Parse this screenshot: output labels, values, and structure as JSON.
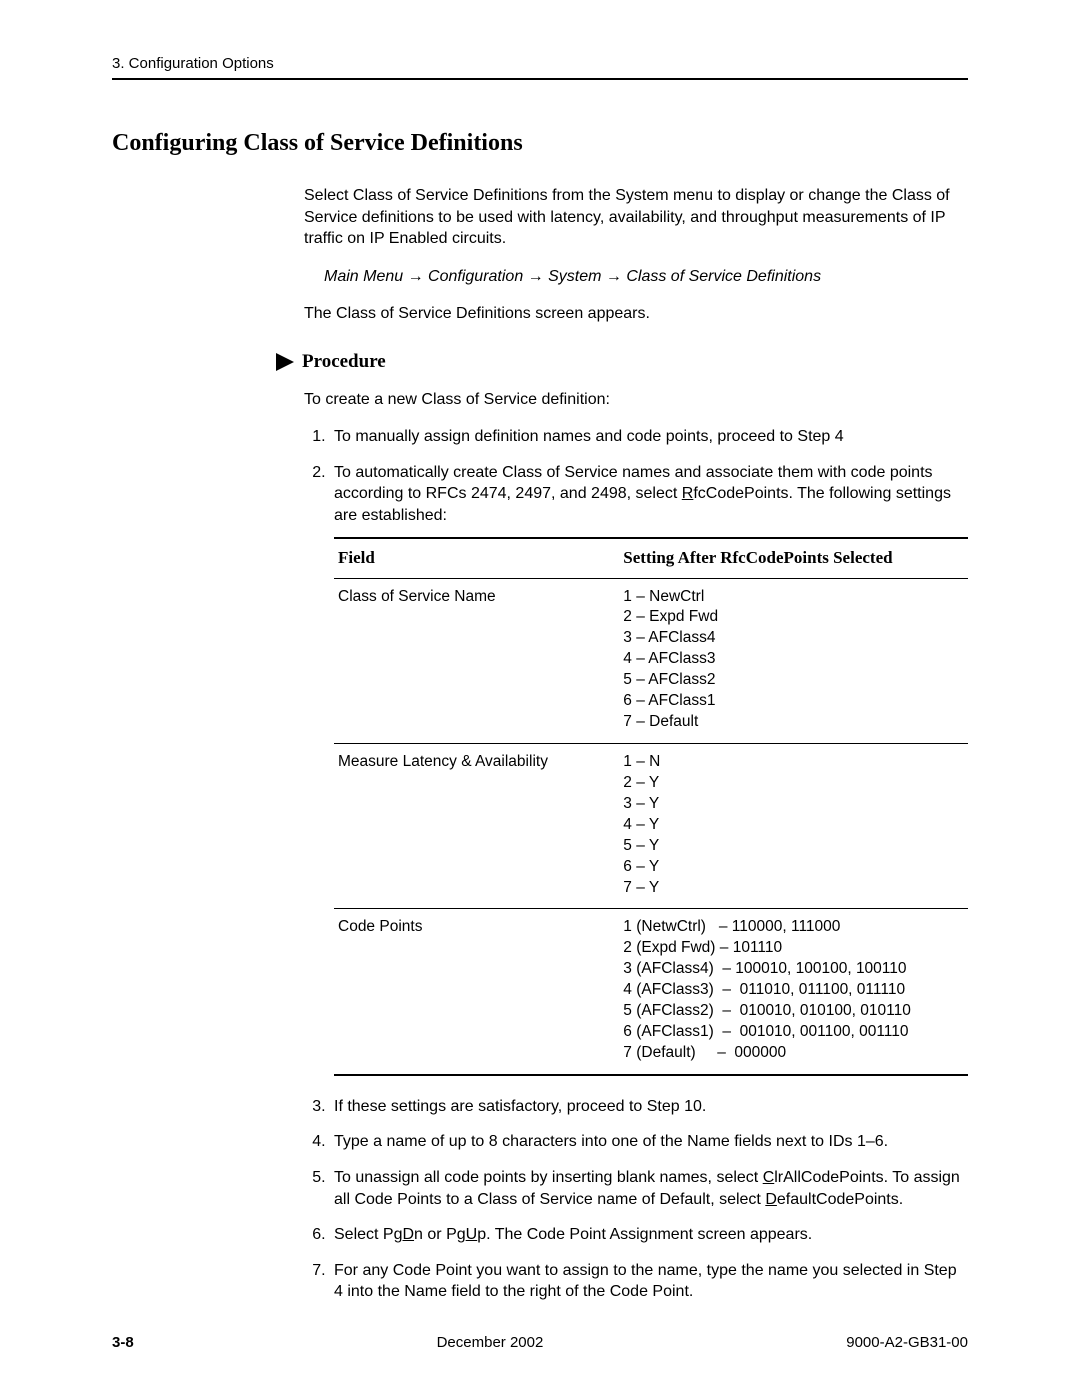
{
  "header": {
    "running": "3. Configuration Options"
  },
  "title": "Configuring Class of Service Definitions",
  "intro": "Select Class of Service Definitions from the System menu to display or change the Class of Service definitions to be used with latency, availability, and throughput measurements of IP traffic on IP Enabled circuits.",
  "navpath": "Main Menu → Configuration → System → Class of Service Definitions",
  "after_nav": "The Class of Service Definitions screen appears.",
  "procedure_label": "Procedure",
  "proc_intro": "To create a new Class of Service definition:",
  "steps": {
    "s1a": "To manually assign definition names and code points, proceed to ",
    "s1b": "Step 4",
    "s2a": "To automatically create Class of Service names and associate them with code points according to RFCs 2474, 2497, and 2498, select ",
    "s2b": "fcCodePoints. The following settings are established:",
    "s3a": "If these settings are satisfactory, proceed to ",
    "s3b": "Step 10",
    "s3c": ".",
    "s4": "Type a name of up to 8 characters into one of the Name fields next to IDs 1–6.",
    "s5a": "To unassign all code points by inserting blank names, select ",
    "s5b": "lrAllCodePoints. To assign all Code Points to a Class of Service name of Default, select ",
    "s5c": "efaultCodePoints.",
    "s6a": "Select Pg",
    "s6b": "n or Pg",
    "s6c": "p. The Code Point Assignment screen appears.",
    "s7a": "For any Code Point you want to assign to the name, type the name you selected in ",
    "s7b": "Step 4",
    "s7c": " into the Name field to the right of the Code Point."
  },
  "mnemonics": {
    "R": "R",
    "C": "C",
    "D": "D",
    "Dn": "D",
    "Up": "U"
  },
  "table": {
    "h1": "Field",
    "h2": "Setting After RfcCodePoints Selected",
    "rows": [
      {
        "field": "Class of Service Name",
        "setting": "1 – NewCtrl\n2 – Expd Fwd\n3 – AFClass4\n4 – AFClass3\n5 – AFClass2\n6 – AFClass1\n7 – Default"
      },
      {
        "field": "Measure Latency & Availability",
        "setting": "1 – N\n2 – Y\n3 – Y\n4 – Y\n5 – Y\n6 – Y\n7 – Y"
      },
      {
        "field": "Code Points",
        "setting": "1 (NetwCtrl)   – 110000, 111000\n2 (Expd Fwd) – 101110\n3 (AFClass4)  – 100010, 100100, 100110\n4 (AFClass3)  –  011010, 011100, 011110\n5 (AFClass2)  –  010010, 010100, 010110\n6 (AFClass1)  –  001010, 001100, 001110\n7 (Default)     –  000000"
      }
    ]
  },
  "footer": {
    "page": "3-8",
    "center": "December 2002",
    "right": "9000-A2-GB31-00"
  }
}
